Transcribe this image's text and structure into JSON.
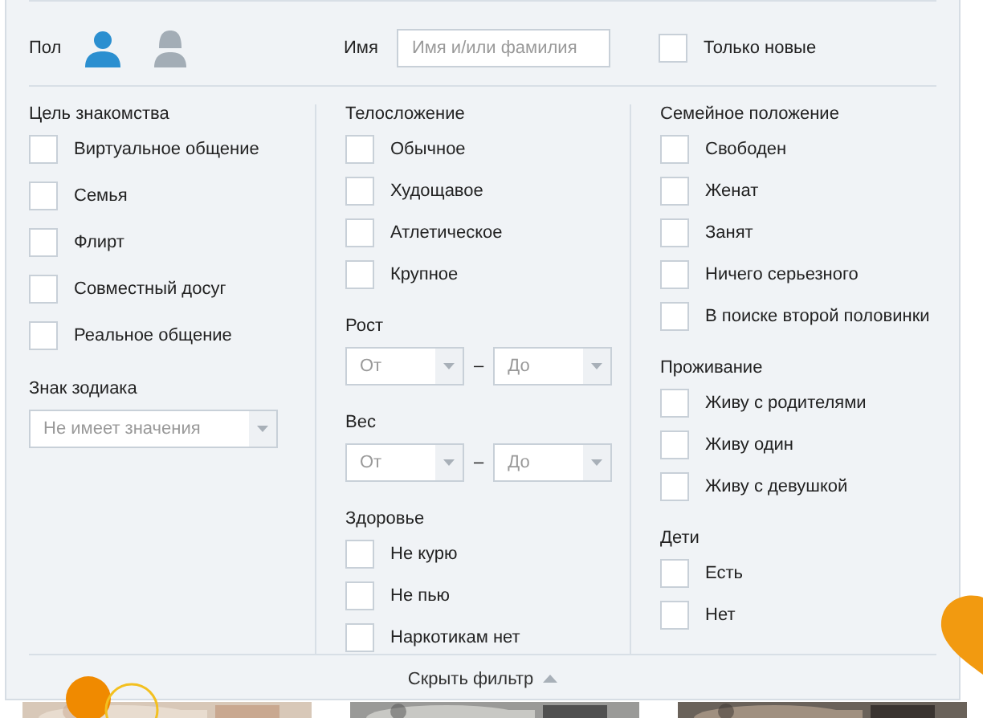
{
  "header": {
    "gender": {
      "label": "Пол",
      "options": [
        {
          "kind": "male",
          "selected": true
        },
        {
          "kind": "female",
          "selected": false
        }
      ]
    },
    "name": {
      "label": "Имя",
      "placeholder": "Имя и/или фамилия"
    },
    "only_new": {
      "label": "Только новые",
      "checked": false
    }
  },
  "columns": [
    {
      "sections": [
        {
          "kind": "checkboxes",
          "title": "Цель знакомства",
          "items": [
            {
              "label": "Виртуальное общение",
              "checked": false
            },
            {
              "label": "Семья",
              "checked": false
            },
            {
              "label": "Флирт",
              "checked": false
            },
            {
              "label": "Совместный досуг",
              "checked": false
            },
            {
              "label": "Реальное общение",
              "checked": false
            }
          ]
        },
        {
          "kind": "select",
          "title": "Знак зодиака",
          "value": "Не имеет значения"
        }
      ]
    },
    {
      "sections": [
        {
          "kind": "checkboxes",
          "title": "Телосложение",
          "items": [
            {
              "label": "Обычное",
              "checked": false
            },
            {
              "label": "Худощавое",
              "checked": false
            },
            {
              "label": "Атлетическое",
              "checked": false
            },
            {
              "label": "Крупное",
              "checked": false
            }
          ]
        },
        {
          "kind": "range",
          "title": "Рост",
          "from": "От",
          "separator": "–",
          "to": "До"
        },
        {
          "kind": "range",
          "title": "Вес",
          "from": "От",
          "separator": "–",
          "to": "До"
        },
        {
          "kind": "checkboxes",
          "title": "Здоровье",
          "items": [
            {
              "label": "Не курю",
              "checked": false
            },
            {
              "label": "Не пью",
              "checked": false
            },
            {
              "label": "Наркотикам нет",
              "checked": false
            }
          ]
        }
      ]
    },
    {
      "sections": [
        {
          "kind": "checkboxes",
          "title": "Семейное положение",
          "items": [
            {
              "label": "Свободен",
              "checked": false
            },
            {
              "label": "Женат",
              "checked": false
            },
            {
              "label": "Занят",
              "checked": false
            },
            {
              "label": "Ничего серьезного",
              "checked": false
            },
            {
              "label": "В поиске второй половинки",
              "checked": false
            }
          ]
        },
        {
          "kind": "checkboxes",
          "title": "Проживание",
          "items": [
            {
              "label": "Живу с родителями",
              "checked": false
            },
            {
              "label": "Живу один",
              "checked": false
            },
            {
              "label": "Живу с девушкой",
              "checked": false
            }
          ]
        },
        {
          "kind": "checkboxes",
          "title": "Дети",
          "items": [
            {
              "label": "Есть",
              "checked": false
            },
            {
              "label": "Нет",
              "checked": false
            }
          ]
        }
      ]
    }
  ],
  "footer": {
    "label": "Скрыть фильтр"
  }
}
